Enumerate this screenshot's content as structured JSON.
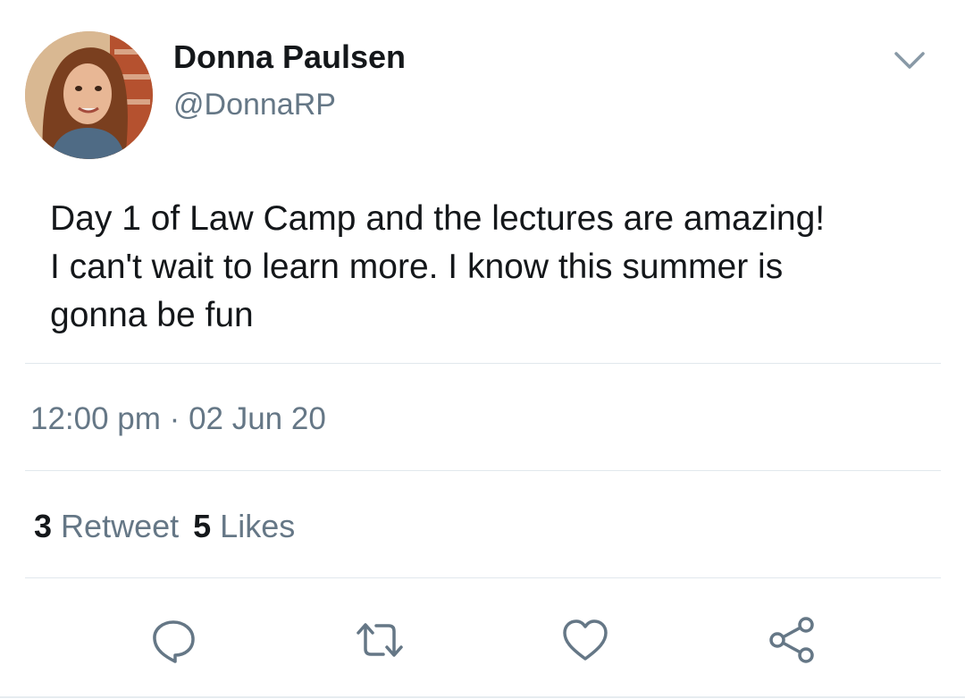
{
  "user": {
    "display_name": "Donna Paulsen",
    "handle": "@DonnaRP"
  },
  "tweet": {
    "lines": [
      "Day 1 of Law Camp and the lectures are amazing!",
      "I can't wait to learn more. I know this summer is",
      "gonna be fun"
    ],
    "time": "12:00 pm",
    "separator": "·",
    "date": "02 Jun 20"
  },
  "stats": {
    "retweet_count": "3",
    "retweet_label": "Retweet",
    "likes_count": "5",
    "likes_label": "Likes"
  },
  "icons": {
    "caret": "chevron-down-icon",
    "reply": "reply-icon",
    "retweet": "retweet-icon",
    "like": "heart-icon",
    "share": "share-icon"
  },
  "colors": {
    "text_primary": "#14171a",
    "text_secondary": "#657786",
    "divider": "#e1e8ed",
    "icon": "#657786"
  }
}
